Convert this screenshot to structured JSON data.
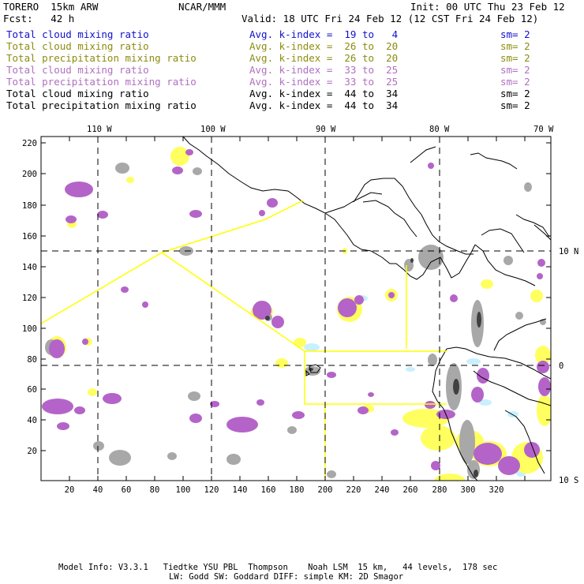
{
  "header": {
    "model": "TORERO  15km ARW",
    "org": "NCAR/MMM",
    "init": "Init: 00 UTC Thu 23 Feb 12",
    "fcst": "Fcst:   42 h",
    "valid": "Valid: 18 UTC Fri 24 Feb 12 (12 CST Fri 24 Feb 12)"
  },
  "legend": [
    {
      "label": "Total cloud mixing ratio",
      "kindex": "Avg. k-index =  19 to   4",
      "sm": "sm= 2",
      "color": "#1010d0"
    },
    {
      "label": "Total cloud mixing ratio",
      "kindex": "Avg. k-index =  26 to  20",
      "sm": "sm= 2",
      "color": "#8c8c10"
    },
    {
      "label": "Total precipitation mixing ratio",
      "kindex": "Avg. k-index =  26 to  20",
      "sm": "sm= 2",
      "color": "#8c8c10"
    },
    {
      "label": "Total cloud mixing ratio",
      "kindex": "Avg. k-index =  33 to  25",
      "sm": "sm= 2",
      "color": "#b070c0"
    },
    {
      "label": "Total precipitation mixing ratio",
      "kindex": "Avg. k-index =  33 to  25",
      "sm": "sm= 2",
      "color": "#b070c0"
    },
    {
      "label": "Total cloud mixing ratio",
      "kindex": "Avg. k-index =  44 to  34",
      "sm": "sm= 2",
      "color": "#000000"
    },
    {
      "label": "Total precipitation mixing ratio",
      "kindex": "Avg. k-index =  44 to  34",
      "sm": "sm= 2",
      "color": "#000000"
    }
  ],
  "axes": {
    "top_labels": [
      "110 W",
      "100 W",
      "90 W",
      "80 W",
      "70 W"
    ],
    "right_labels": [
      "10 N",
      "0",
      "10 S"
    ],
    "y_ticks": [
      "220",
      "200",
      "180",
      "160",
      "140",
      "120",
      "100",
      "80",
      "60",
      "40",
      "20"
    ],
    "x_ticks": [
      "20",
      "40",
      "60",
      "80",
      "100",
      "120",
      "140",
      "160",
      "180",
      "200",
      "220",
      "240",
      "260",
      "280",
      "300",
      "320"
    ]
  },
  "colors": {
    "purple": "#b060c0",
    "yellow": "#ffff60",
    "gray": "#a0a0a0",
    "light_blue": "#c8f0ff",
    "boundary": "#ffff00"
  },
  "footer": {
    "line1": "Model Info: V3.3.1   Tiedtke YSU PBL  Thompson    Noah LSM  15 km,   44 levels,  178 sec",
    "line2": "LW: Godd SW: Goddard DIFF: simple KM: 2D Smagor"
  }
}
